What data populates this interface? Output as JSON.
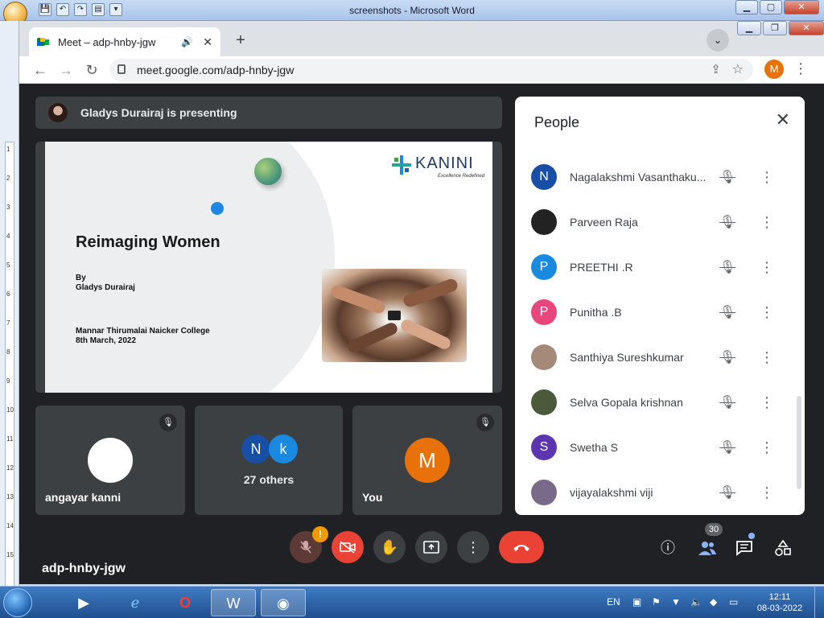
{
  "word": {
    "title": "screenshots - Microsoft Word",
    "quick_access": [
      "💾",
      "↶",
      "↷",
      "▤",
      "▾"
    ],
    "ruler_numbers": [
      "1",
      "2",
      "3",
      "4",
      "5",
      "6",
      "7",
      "8",
      "9",
      "10",
      "11",
      "12",
      "13",
      "14",
      "15"
    ]
  },
  "browser": {
    "tab_title": "Meet – adp-hnby-jgw",
    "url": "meet.google.com/adp-hnby-jgw",
    "profile_initial": "M",
    "colors": {
      "tab_bar": "#dee1e6",
      "omnibox": "#f1f3f4",
      "profile": "#e8710a"
    }
  },
  "meet": {
    "presenting_text": "Gladys Durairaj is presenting",
    "meeting_code": "adp-hnby-jgw",
    "slide": {
      "brand": "KANINI",
      "brand_tagline": "Excellence Redefined",
      "title": "Reimaging Women",
      "by": "By",
      "author": "Gladys Durairaj",
      "college": "Mannar Thirumalai Naicker College",
      "date": "8th March, 2022"
    },
    "tiles": [
      {
        "label": "angayar kanni",
        "muted": true
      },
      {
        "label": "27 others",
        "avatars": [
          "N",
          "k"
        ]
      },
      {
        "label": "You",
        "avatar": "M",
        "muted": true
      }
    ],
    "controls": {
      "mic_warning": "!",
      "people_count": "30"
    },
    "colors": {
      "bg": "#202124",
      "tile": "#3c4043",
      "danger": "#ea4335",
      "warning": "#f29900"
    }
  },
  "people_panel": {
    "title": "People",
    "participants": [
      {
        "name": "Nagalakshmi Vasanthaku...",
        "initial": "N",
        "color": "#174ea6"
      },
      {
        "name": "Parveen Raja",
        "initial": "",
        "color": "#222222"
      },
      {
        "name": "PREETHI .R",
        "initial": "P",
        "color": "#1a8ae0"
      },
      {
        "name": "Punitha .B",
        "initial": "P",
        "color": "#e8467c"
      },
      {
        "name": "Santhiya Sureshkumar",
        "initial": "",
        "color": "#a58a7a"
      },
      {
        "name": "Selva Gopala krishnan",
        "initial": "",
        "color": "#4a5a3a"
      },
      {
        "name": "Swetha S",
        "initial": "S",
        "color": "#5e35b1"
      },
      {
        "name": "vijayalakshmi viji",
        "initial": "",
        "color": "#7a6a8a"
      }
    ]
  },
  "taskbar": {
    "language": "EN",
    "time": "12:11",
    "date": "08-03-2022"
  }
}
